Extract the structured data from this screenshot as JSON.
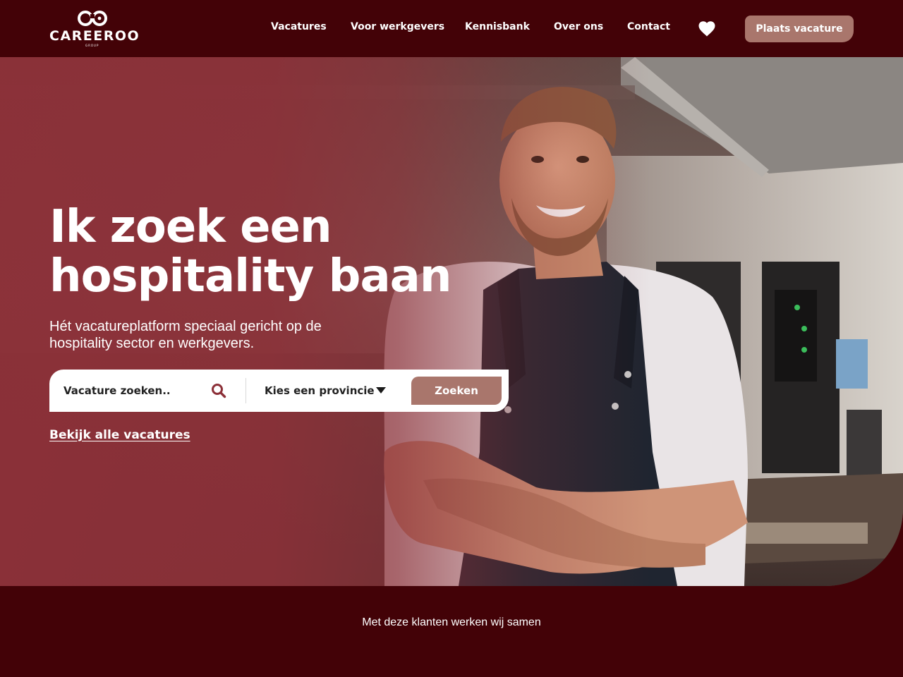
{
  "brand": {
    "name": "CAREEROO",
    "sub": "GROUP"
  },
  "nav": {
    "links": [
      {
        "label": "Vacatures"
      },
      {
        "label": "Voor werkgevers"
      },
      {
        "label": "Kennisbank"
      },
      {
        "label": "Over ons"
      },
      {
        "label": "Contact"
      }
    ],
    "favorites_icon": "heart-icon",
    "cta_label": "Plaats vacature"
  },
  "hero": {
    "title_line1": "Ik zoek een",
    "title_line2": "hospitality baan",
    "subtitle": "Hét vacatureplatform speciaal gericht op de hospitality sector en werkgevers.",
    "search": {
      "placeholder": "Vacature zoeken..",
      "search_icon": "search-icon",
      "province_label": "Kies een provincie",
      "province_icon": "chevron-down-icon",
      "button_label": "Zoeken"
    },
    "all_jobs_link": "Bekijk alle vacatures",
    "image": "smiling-chef-in-kitchen"
  },
  "clients": {
    "heading": "Met deze klanten werken wij samen"
  },
  "colors": {
    "background": "#430207",
    "hero_overlay": "#8c3038",
    "accent": "#a9766c",
    "text": "#ffffff"
  }
}
